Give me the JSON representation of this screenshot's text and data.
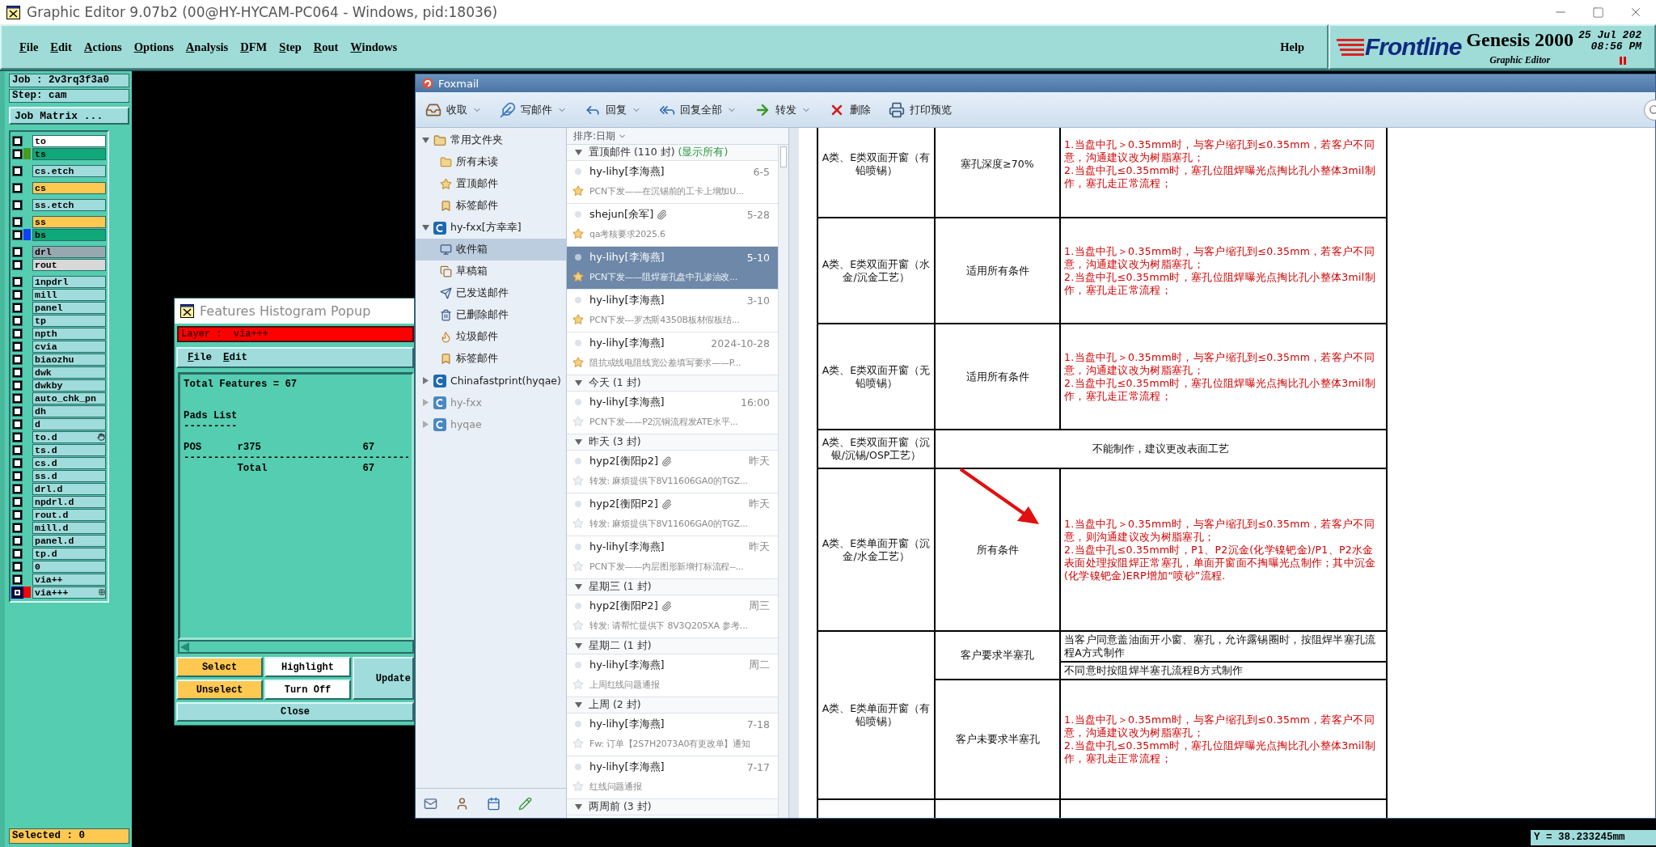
{
  "genesis": {
    "title": "Graphic Editor 9.07b2 (00@HY-HYCAM-PC064 - Windows, pid:18036)",
    "menus": [
      "File",
      "Edit",
      "Actions",
      "Options",
      "Analysis",
      "DFM",
      "Step",
      "Rout",
      "Windows"
    ],
    "help": "Help",
    "brand": {
      "logo": "Frontline",
      "product": "Genesis 2000",
      "subtitle": "Graphic Editor",
      "date": "25 Jul 202",
      "time": "08:56 PM"
    },
    "job": "Job : 2v3rq3f3a0",
    "step": "Step: cam",
    "job_matrix": "Job Matrix ...",
    "layer_groups": [
      {
        "layers": [
          {
            "name": "to",
            "kind": "silk",
            "selected": false
          },
          {
            "name": "ts",
            "kind": "mask",
            "color": "#4a9a20",
            "selected": false
          }
        ]
      },
      {
        "layers": [
          {
            "name": "cs.etch",
            "kind": "plain",
            "selected": false
          }
        ]
      },
      {
        "layers": [
          {
            "name": "cs",
            "kind": "signal",
            "selected": false
          }
        ]
      },
      {
        "layers": [
          {
            "name": "ss.etch",
            "kind": "plain",
            "selected": false
          }
        ]
      },
      {
        "layers": [
          {
            "name": "ss",
            "kind": "signal",
            "selected": false
          },
          {
            "name": "bs",
            "kind": "mask",
            "color": "#1040ff",
            "selected": false
          }
        ]
      },
      {
        "layers": [
          {
            "name": "drl",
            "kind": "drill",
            "selected": false
          },
          {
            "name": "rout",
            "kind": "rout",
            "selected": false
          }
        ]
      },
      {
        "layers": [
          {
            "name": "1npdrl",
            "kind": "plain",
            "selected": false
          },
          {
            "name": "mill",
            "kind": "plain",
            "selected": false
          },
          {
            "name": "panel",
            "kind": "plain",
            "selected": false
          },
          {
            "name": "tp",
            "kind": "plain",
            "selected": false
          },
          {
            "name": "npth",
            "kind": "plain",
            "selected": false
          },
          {
            "name": "cvia",
            "kind": "plain",
            "selected": false
          },
          {
            "name": "biaozhu",
            "kind": "plain",
            "selected": false
          },
          {
            "name": "dwk",
            "kind": "plain",
            "selected": false
          },
          {
            "name": "dwkby",
            "kind": "plain",
            "selected": false
          },
          {
            "name": "auto_chk_pn",
            "kind": "plain",
            "selected": false
          },
          {
            "name": "dh",
            "kind": "plain",
            "selected": false
          },
          {
            "name": "d",
            "kind": "plain",
            "selected": false
          },
          {
            "name": "to.d",
            "kind": "plain",
            "selected": false
          },
          {
            "name": "ts.d",
            "kind": "plain",
            "selected": false
          },
          {
            "name": "cs.d",
            "kind": "plain",
            "selected": false
          },
          {
            "name": "ss.d",
            "kind": "plain",
            "selected": false
          },
          {
            "name": "drl.d",
            "kind": "plain",
            "selected": false
          },
          {
            "name": "npdrl.d",
            "kind": "plain",
            "selected": false
          },
          {
            "name": "rout.d",
            "kind": "plain",
            "selected": false
          },
          {
            "name": "mill.d",
            "kind": "plain",
            "selected": false
          },
          {
            "name": "panel.d",
            "kind": "plain",
            "selected": false
          },
          {
            "name": "tp.d",
            "kind": "plain",
            "selected": false
          },
          {
            "name": "0",
            "kind": "plain",
            "selected": false
          },
          {
            "name": "via++",
            "kind": "plain",
            "selected": false
          },
          {
            "name": "via+++",
            "kind": "plain",
            "color": "#ff0000",
            "selected": true
          }
        ]
      }
    ],
    "selected_count": "Selected : 0",
    "coordinate_y": "Y = 38.233245mm"
  },
  "histogram_popup": {
    "title": "Features Histogram Popup",
    "layer": "Layer :  via+++",
    "menus": [
      "File",
      "Edit"
    ],
    "report": "Total Features = 67\n\n\nPads List\n---------\n\nPOS      r375                 67\n--------------------------------------\n         Total                67",
    "buttons": [
      {
        "label": "Select",
        "kind": "active"
      },
      {
        "label": "Highlight",
        "kind": "plain"
      },
      {
        "label": "Unselect",
        "kind": "active"
      },
      {
        "label": "Turn Off",
        "kind": "plain"
      }
    ],
    "update": "Update",
    "close": "Close"
  },
  "foxmail": {
    "title": "Foxmail",
    "toolbar": [
      {
        "label": "收取",
        "dropdown": true
      },
      {
        "label": "写邮件",
        "dropdown": true
      },
      {
        "label": "回复",
        "dropdown": true
      },
      {
        "label": "回复全部",
        "dropdown": true
      },
      {
        "label": "转发",
        "dropdown": true
      },
      {
        "label": "删除",
        "dropdown": false
      },
      {
        "label": "打印预览",
        "dropdown": false
      }
    ],
    "folders": [
      {
        "label": "常用文件夹",
        "kind": "group",
        "expanded": true,
        "dimmed": false,
        "children": [
          {
            "label": "所有未读",
            "selected": false
          },
          {
            "label": "置顶邮件",
            "selected": false
          },
          {
            "label": "标签邮件",
            "selected": false
          }
        ]
      },
      {
        "label": "hy-fxx[方幸幸]",
        "kind": "account",
        "expanded": true,
        "dimmed": false,
        "children": [
          {
            "label": "收件箱",
            "selected": true
          },
          {
            "label": "草稿箱",
            "selected": false
          },
          {
            "label": "已发送邮件",
            "selected": false
          },
          {
            "label": "已删除邮件",
            "selected": false
          },
          {
            "label": "垃圾邮件",
            "selected": false
          },
          {
            "label": "标签邮件",
            "selected": false
          }
        ]
      },
      {
        "label": "Chinafastprint(hyqae)",
        "kind": "account",
        "expanded": false,
        "dimmed": false
      },
      {
        "label": "hy-fxx",
        "kind": "account",
        "expanded": false,
        "dimmed": true
      },
      {
        "label": "hyqae",
        "kind": "account",
        "expanded": false,
        "dimmed": true
      }
    ],
    "sort": "排序:日期",
    "mail_groups": [
      {
        "label": "置顶邮件 (110 封)",
        "note": "(显示所有)",
        "mails": [
          {
            "sender": "hy-lihy[李海燕]",
            "date": "6-5",
            "subject": "PCN下发——在沉锡前的工卡上增加U...",
            "attachment": false,
            "starred": true,
            "selected": false
          },
          {
            "sender": "shejun[余军]",
            "date": "5-28",
            "subject": "qa考核要求2025.6",
            "attachment": true,
            "starred": true,
            "selected": false
          },
          {
            "sender": "hy-lihy[李海燕]",
            "date": "5-10",
            "subject": "PCN下发——阻焊塞孔盘中孔渗油改...",
            "attachment": false,
            "starred": true,
            "selected": true
          },
          {
            "sender": "hy-lihy[李海燕]",
            "date": "3-10",
            "subject": "PCN下发---罗杰斯4350B板材假板结...",
            "attachment": false,
            "starred": true,
            "selected": false
          },
          {
            "sender": "hy-lihy[李海燕]",
            "date": "2024-10-28",
            "subject": "阻抗或线电阻线宽公差填写要求——P...",
            "attachment": false,
            "starred": true,
            "selected": false
          }
        ]
      },
      {
        "label": "今天 (1 封)",
        "mails": [
          {
            "sender": "hy-lihy[李海燕]",
            "date": "16:00",
            "subject": "PCN下发——P2沉铜流程发ATE水平...",
            "attachment": false,
            "starred": false,
            "selected": false
          }
        ]
      },
      {
        "label": "昨天 (3 封)",
        "mails": [
          {
            "sender": "hyp2[衡阳p2]",
            "date": "昨天",
            "subject": "转发: 麻烦提供下8V11606GA0的TGZ...",
            "attachment": true,
            "starred": false,
            "selected": false
          },
          {
            "sender": "hyp2[衡阳P2]",
            "date": "昨天",
            "subject": "转发: 麻烦提供下8V11606GA0的TGZ...",
            "attachment": true,
            "starred": false,
            "selected": false
          },
          {
            "sender": "hy-lihy[李海燕]",
            "date": "昨天",
            "subject": "PCN下发——内层图形新增打标流程--...",
            "attachment": false,
            "starred": false,
            "selected": false
          }
        ]
      },
      {
        "label": "星期三 (1 封)",
        "mails": [
          {
            "sender": "hyp2[衡阳P2]",
            "date": "周三",
            "subject": "转发: 请帮忙提供下 8V3Q205XA 参考...",
            "attachment": true,
            "starred": false,
            "selected": false
          }
        ]
      },
      {
        "label": "星期二 (1 封)",
        "mails": [
          {
            "sender": "hy-lihy[李海燕]",
            "date": "周二",
            "subject": "上周红线问题通报",
            "attachment": false,
            "starred": false,
            "selected": false
          }
        ]
      },
      {
        "label": "上周 (2 封)",
        "mails": [
          {
            "sender": "hy-lihy[李海燕]",
            "date": "7-18",
            "subject": "Fw: 订单【2S7H2073A0有更改单】通知",
            "attachment": false,
            "starred": false,
            "selected": false
          },
          {
            "sender": "hy-lihy[李海燕]",
            "date": "7-17",
            "subject": "红线问题通报",
            "attachment": false,
            "starred": false,
            "selected": false
          }
        ]
      },
      {
        "label": "两周前 (3 封)"
      }
    ],
    "document": {
      "rows": [
        {
          "kind": "standard",
          "category": "A类、E类双面开窗（有铅喷锡）",
          "conditions": [
            {
              "condition": "塞孔深度≥70%",
              "cells": [
                {
                  "emphasized": true,
                  "lines": [
                    "1.当盘中孔＞0.35mm时，与客户缩孔到≤0.35mm，若客户不同意，沟通建议改为树脂塞孔；",
                    "2.当盘中孔≤0.35mm时，塞孔位阻焊曝光点掏比孔小整体3mil制作，塞孔走正常流程；"
                  ]
                }
              ]
            }
          ]
        },
        {
          "kind": "standard",
          "category": "A类、E类双面开窗（水金/沉金工艺）",
          "conditions": [
            {
              "condition": "适用所有条件",
              "cells": [
                {
                  "emphasized": true,
                  "lines": [
                    "1.当盘中孔＞0.35mm时，与客户缩孔到≤0.35mm，若客户不同意，沟通建议改为树脂塞孔；",
                    "2.当盘中孔≤0.35mm时，塞孔位阻焊曝光点掏比孔小整体3mil制作，塞孔走正常流程；"
                  ]
                }
              ]
            }
          ]
        },
        {
          "kind": "standard",
          "category": "A类、E类双面开窗（无铅喷锡）",
          "conditions": [
            {
              "condition": "适用所有条件",
              "cells": [
                {
                  "emphasized": true,
                  "lines": [
                    "1.当盘中孔＞0.35mm时，与客户缩孔到≤0.35mm，若客户不同意，沟通建议改为树脂塞孔；",
                    "2.当盘中孔≤0.35mm时，塞孔位阻焊曝光点掏比孔小整体3mil制作，塞孔走正常流程；"
                  ]
                }
              ]
            }
          ]
        },
        {
          "kind": "merged",
          "category": "A类、E类双面开窗（沉银/沉锡/OSP工艺）",
          "note": "不能制作，建议更改表面工艺"
        },
        {
          "kind": "standard",
          "category": "A类、E类单面开窗（沉金/水金工艺）",
          "conditions": [
            {
              "condition": "所有条件",
              "cells": [
                {
                  "emphasized": true,
                  "lines": [
                    "1.当盘中孔＞0.35mm时，与客户缩孔到≤0.35mm，若客户不同意，则沟通建议改为树脂塞孔；",
                    "2.当盘中孔≤0.35mm时，P1、P2沉金(化学镍钯金)/P1、P2水金表面处理按阻焊正常塞孔，单面开窗面不掏曝光点制作；其中沉金(化学镍钯金)ERP增加“喷砂”流程."
                  ]
                }
              ]
            }
          ]
        },
        {
          "kind": "standard",
          "category": "A类、E类单面开窗（有铅喷锡）",
          "conditions": [
            {
              "condition": "客户要求半塞孔",
              "cells": [
                {
                  "emphasized": false,
                  "lines": [
                    "当客户同意盖油面开小窗、塞孔，允许露锡圈时，按阻焊半塞孔流程A方式制作"
                  ]
                },
                {
                  "emphasized": false,
                  "lines": [
                    "不同意时按阻焊半塞孔流程B方式制作"
                  ]
                }
              ]
            },
            {
              "condition": "客户未要求半塞孔",
              "cells": [
                {
                  "emphasized": true,
                  "lines": [
                    "1.当盘中孔＞0.35mm时，与客户缩孔到≤0.35mm，若客户不同意，沟通建议改为树脂塞孔；",
                    "2.当盘中孔≤0.35mm时，塞孔位阻焊曝光点掏比孔小整体3mil制作，塞孔走正常流程；"
                  ]
                }
              ]
            }
          ]
        },
        {
          "kind": "blank"
        }
      ]
    }
  }
}
